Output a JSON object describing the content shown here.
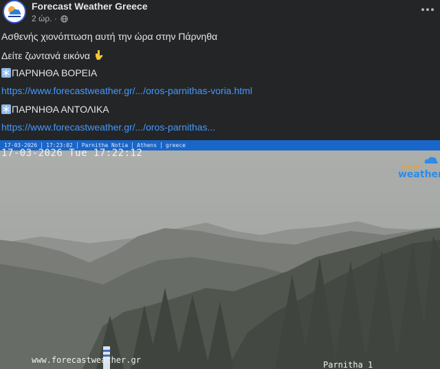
{
  "post": {
    "page_name": "Forecast Weather Greece",
    "time": "2 ώρ.",
    "separator": "·",
    "text_line_1": "Ασθενής χιονόπτωση αυτή την ώρα στην Πάρνηθα",
    "text_line_2": "Δείτε ζωντανά εικόνα",
    "section_1_title": "ΠΑΡΝΗΘΑ ΒΟΡΕΙΑ",
    "section_1_link": "https://www.forecastweather.gr/.../oros-parnithas-voria.html",
    "section_2_title": "ΠΑΡΝΗΘΑ ΑΝΤΟΛΙΚΑ",
    "section_2_link": "https://www.forecastweather.gr/.../oros-parnithas...",
    "icons": {
      "avatar": "forecast-weather-logo",
      "audience": "globe-icon",
      "more": "more-options-icon",
      "snowflake": "snowflake-icon",
      "pointing": "pointing-down-hand-icon"
    }
  },
  "webcam": {
    "osd": [
      "17-03-2026",
      "17:23:02",
      "Parnitha Notia",
      "Athens",
      "greece"
    ],
    "timestamp": "17-03-2026 Tue 17:22:12",
    "logo_small": "forecast",
    "logo_main": "weather",
    "watermark": "www.forecastweather.gr",
    "camera_label": "Parnitha 1"
  },
  "colors": {
    "background": "#242526",
    "text": "#e4e6eb",
    "secondary_text": "#b0b3b8",
    "link": "#4599ff",
    "osd_bar": "#1a66c8"
  }
}
